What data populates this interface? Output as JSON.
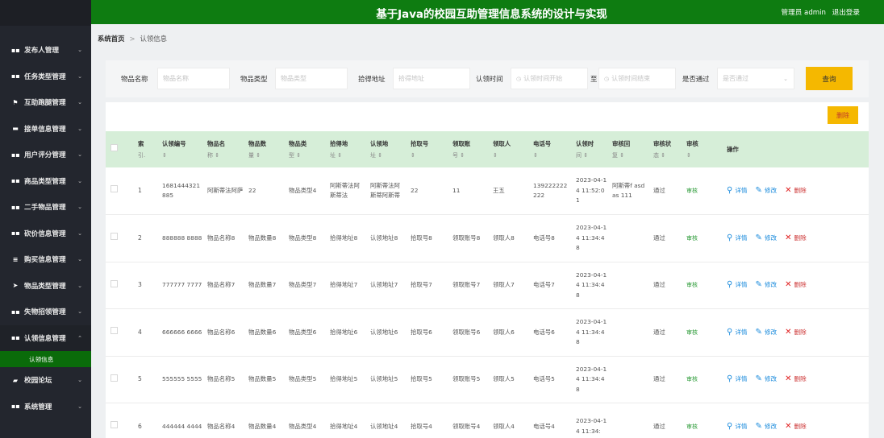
{
  "header": {
    "title": "基于Java的校园互助管理信息系统的设计与实现",
    "user": "管理员 admin",
    "logout": "退出登录"
  },
  "sidebar": {
    "items": [
      {
        "label": "发布人管理",
        "icon": "grid-icon"
      },
      {
        "label": "任务类型管理",
        "icon": "grid-icon"
      },
      {
        "label": "互助跑腿管理",
        "icon": "flag-icon"
      },
      {
        "label": "接单信息管理",
        "icon": "card-icon"
      },
      {
        "label": "用户评分管理",
        "icon": "grid-icon"
      },
      {
        "label": "商品类型管理",
        "icon": "grid-icon"
      },
      {
        "label": "二手物品管理",
        "icon": "grid-icon"
      },
      {
        "label": "砍价信息管理",
        "icon": "grid-icon"
      },
      {
        "label": "购买信息管理",
        "icon": "list-icon"
      },
      {
        "label": "物品类型管理",
        "icon": "send-icon"
      },
      {
        "label": "失物招领管理",
        "icon": "grid-icon"
      },
      {
        "label": "认领信息管理",
        "icon": "grid-icon"
      },
      {
        "label": "校园论坛",
        "icon": "chat-icon"
      },
      {
        "label": "系统管理",
        "icon": "grid-icon"
      }
    ],
    "open_sub": "认领信息"
  },
  "breadcrumb": {
    "home": "系统首页",
    "sep": ">",
    "current": "认领信息"
  },
  "search": {
    "name_label": "物品名称",
    "name_ph": "物品名称",
    "type_label": "物品类型",
    "type_ph": "物品类型",
    "place_label": "拾得地址",
    "place_ph": "拾得地址",
    "time_label": "认领时间",
    "time_start_ph": "认领时间开始",
    "to": "至",
    "time_end_ph": "认领时间结束",
    "pass_label": "是否通过",
    "pass_ph": "是否通过",
    "query_btn": "查询"
  },
  "table": {
    "delete_btn": "删除",
    "headers": [
      {
        "l1": "索",
        "l2": "引."
      },
      {
        "l1": "认领编号",
        "l2": "⇕"
      },
      {
        "l1": "物品名",
        "l2": "称 ⇕"
      },
      {
        "l1": "物品数",
        "l2": "量 ⇕"
      },
      {
        "l1": "物品类",
        "l2": "型 ⇕"
      },
      {
        "l1": "拾得地",
        "l2": "址 ⇕"
      },
      {
        "l1": "认领地",
        "l2": "址 ⇕"
      },
      {
        "l1": "拾取号",
        "l2": "⇕"
      },
      {
        "l1": "领取账",
        "l2": "号 ⇕"
      },
      {
        "l1": "领取人",
        "l2": "⇕"
      },
      {
        "l1": "电话号",
        "l2": "⇕"
      },
      {
        "l1": "认领时",
        "l2": "间 ⇕"
      },
      {
        "l1": "审核回",
        "l2": "复 ⇕"
      },
      {
        "l1": "审核状",
        "l2": "态 ⇕"
      },
      {
        "l1": "审核",
        "l2": "⇕"
      },
      {
        "l1": "操作",
        "l2": ""
      }
    ],
    "rows": [
      {
        "idx": "1",
        "code": "1681444321885",
        "name": "阿斯蒂法阿萨",
        "qty": "22",
        "type": "物品类型4",
        "found": "阿斯蒂法阿斯蒂法",
        "claim": "阿斯蒂法阿斯蒂阿斯蒂",
        "pick": "22",
        "acct": "11",
        "person": "王五",
        "phone": "139222222222",
        "time": "2023-04-14 11:52:01",
        "reply": "阿斯蒂f asd as 111",
        "status": "通过",
        "audit": "审核"
      },
      {
        "idx": "2",
        "code": "888888 8888",
        "name": "物品名称8",
        "qty": "物品数量8",
        "type": "物品类型8",
        "found": "拾得地址8",
        "claim": "认领地址8",
        "pick": "拾取号8",
        "acct": "领取账号8",
        "person": "领取人8",
        "phone": "电话号8",
        "time": "2023-04-14 11:34:48",
        "reply": "",
        "status": "通过",
        "audit": "审核"
      },
      {
        "idx": "3",
        "code": "777777 7777",
        "name": "物品名称7",
        "qty": "物品数量7",
        "type": "物品类型7",
        "found": "拾得地址7",
        "claim": "认领地址7",
        "pick": "拾取号7",
        "acct": "领取账号7",
        "person": "领取人7",
        "phone": "电话号7",
        "time": "2023-04-14 11:34:48",
        "reply": "",
        "status": "通过",
        "audit": "审核"
      },
      {
        "idx": "4",
        "code": "666666 6666",
        "name": "物品名称6",
        "qty": "物品数量6",
        "type": "物品类型6",
        "found": "拾得地址6",
        "claim": "认领地址6",
        "pick": "拾取号6",
        "acct": "领取账号6",
        "person": "领取人6",
        "phone": "电话号6",
        "time": "2023-04-14 11:34:48",
        "reply": "",
        "status": "通过",
        "audit": "审核"
      },
      {
        "idx": "5",
        "code": "555555 5555",
        "name": "物品名称5",
        "qty": "物品数量5",
        "type": "物品类型5",
        "found": "拾得地址5",
        "claim": "认领地址5",
        "pick": "拾取号5",
        "acct": "领取账号5",
        "person": "领取人5",
        "phone": "电话号5",
        "time": "2023-04-14 11:34:48",
        "reply": "",
        "status": "通过",
        "audit": "审核"
      },
      {
        "idx": "6",
        "code": "444444 4444",
        "name": "物品名称4",
        "qty": "物品数量4",
        "type": "物品类型4",
        "found": "拾得地址4",
        "claim": "认领地址4",
        "pick": "拾取号4",
        "acct": "领取账号4",
        "person": "领取人4",
        "phone": "电话号4",
        "time": "2023-04-14 11:34:",
        "reply": "",
        "status": "通过",
        "audit": "审核"
      }
    ],
    "op_detail": "详情",
    "op_edit": "修改",
    "op_delete": "删除"
  },
  "colors": {
    "header": "#0e7c11",
    "sidebar": "#23262e",
    "accent": "#f5b800",
    "thead": "#d6eed8"
  }
}
